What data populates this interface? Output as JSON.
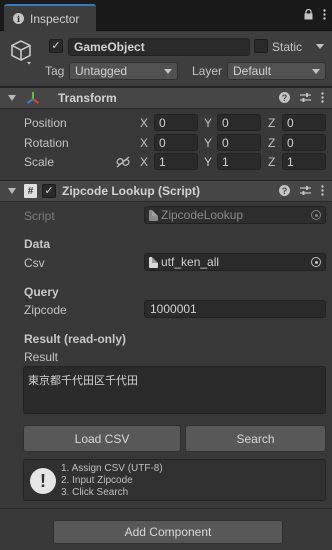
{
  "window": {
    "tab_title": "Inspector"
  },
  "gameobject": {
    "name": "GameObject",
    "static_label": "Static",
    "tag_label": "Tag",
    "tag_value": "Untagged",
    "layer_label": "Layer",
    "layer_value": "Default"
  },
  "transform": {
    "title": "Transform",
    "rows": [
      {
        "label": "Position",
        "x": "0",
        "y": "0",
        "z": "0"
      },
      {
        "label": "Rotation",
        "x": "0",
        "y": "0",
        "z": "0"
      },
      {
        "label": "Scale",
        "x": "1",
        "y": "1",
        "z": "1"
      }
    ],
    "axes": {
      "x": "X",
      "y": "Y",
      "z": "Z"
    }
  },
  "script_component": {
    "title": "Zipcode Lookup (Script)",
    "script_label": "Script",
    "script_value": "ZipcodeLookup",
    "data_header": "Data",
    "csv_label": "Csv",
    "csv_value": "utf_ken_all",
    "query_header": "Query",
    "zipcode_label": "Zipcode",
    "zipcode_value": "1000001",
    "result_header": "Result (read-only)",
    "result_label": "Result",
    "result_value": "東京都千代田区千代田",
    "load_button": "Load CSV",
    "search_button": "Search",
    "help_lines": [
      "1. Assign CSV (UTF-8)",
      "2. Input Zipcode",
      "3. Click Search"
    ]
  },
  "footer": {
    "add_component": "Add Component"
  }
}
